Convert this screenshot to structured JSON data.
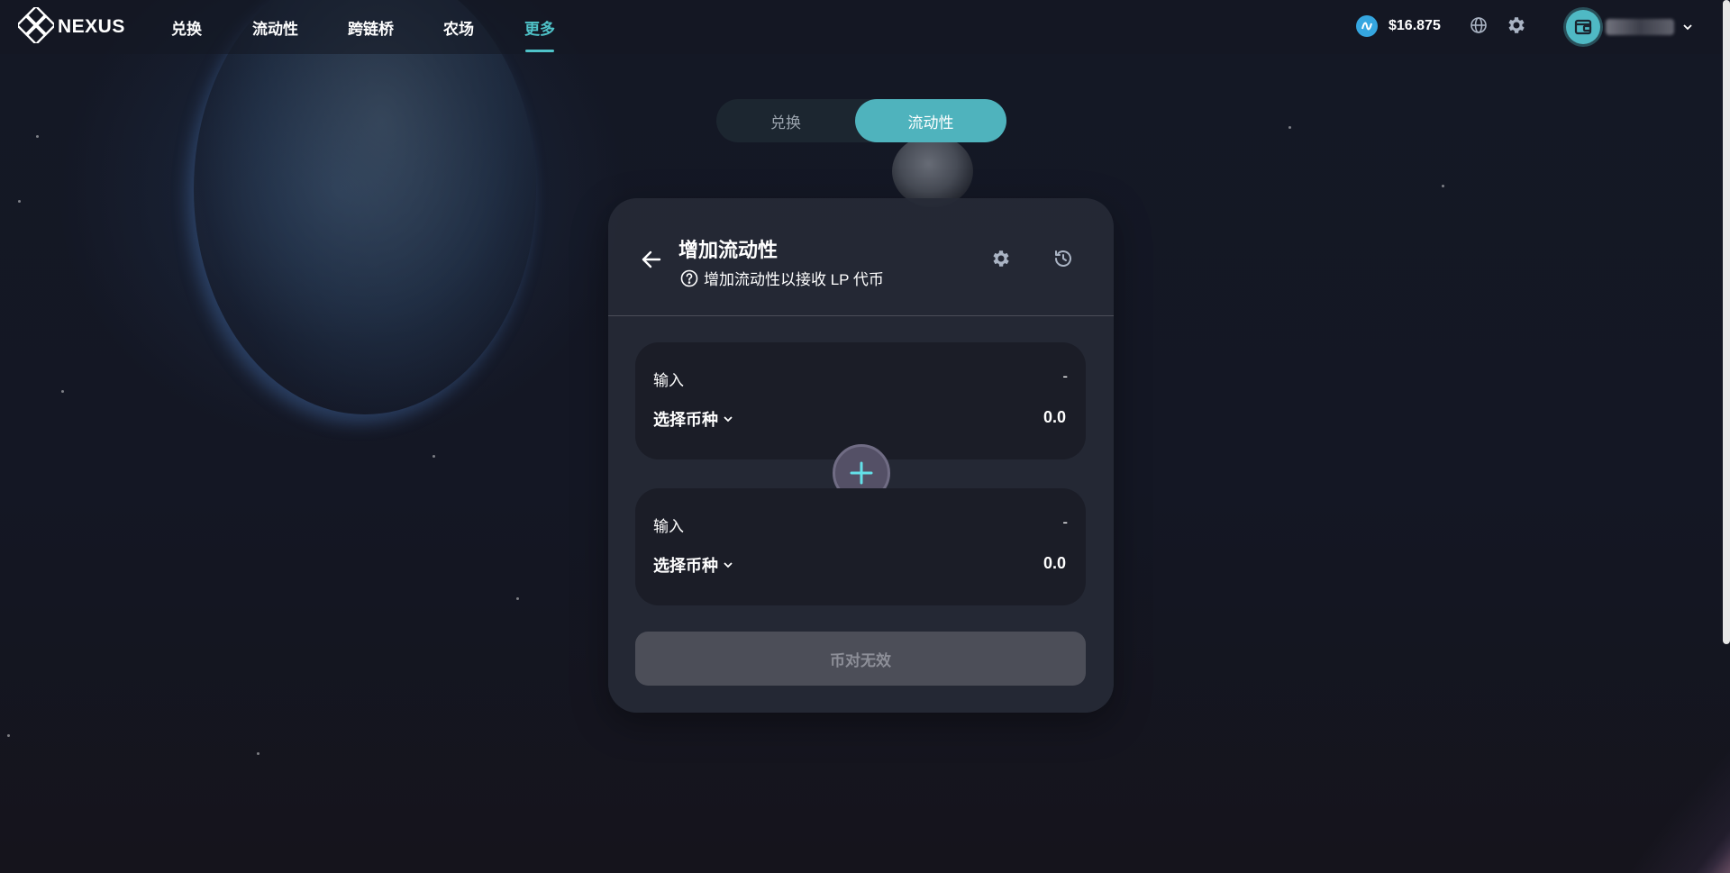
{
  "brand": {
    "logo_text": "NEXUS"
  },
  "nav": {
    "items": [
      {
        "label": "兑换"
      },
      {
        "label": "流动性"
      },
      {
        "label": "跨链桥"
      },
      {
        "label": "农场"
      },
      {
        "label": "更多"
      }
    ],
    "active": "更多"
  },
  "header": {
    "price": "$16.875"
  },
  "toggle": {
    "left_label": "兑换",
    "right_label": "流动性",
    "active": "流动性"
  },
  "card": {
    "title": "增加流动性",
    "subtitle": "增加流动性以接收 LP 代币",
    "input_a": {
      "label": "输入",
      "balance": "-",
      "token_select": "选择币种",
      "amount": "0.0"
    },
    "input_b": {
      "label": "输入",
      "balance": "-",
      "token_select": "选择币种",
      "amount": "0.0"
    },
    "submit_label": "币对无效"
  },
  "colors": {
    "accent": "#4fb3bd",
    "nav_active": "#4fc3c9",
    "card_bg": "#262a36",
    "panel_bg": "#1b1d27",
    "disabled_button": "#4c4e58"
  }
}
